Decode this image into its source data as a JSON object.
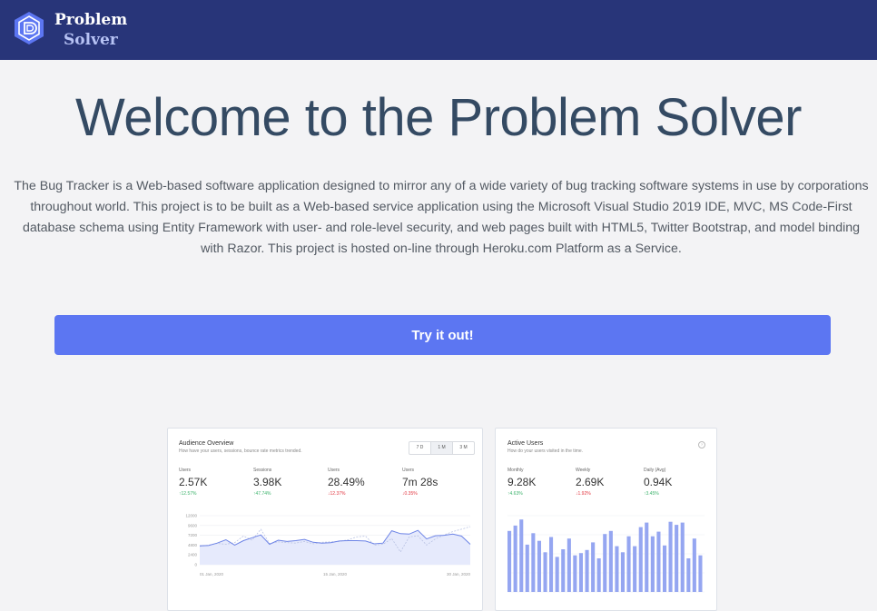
{
  "app": {
    "brand_line1": "Problem",
    "brand_line2": "Solver",
    "brand_icon": "document-hexagon-icon"
  },
  "hero": {
    "title": "Welcome to the Problem Solver",
    "description": "The Bug Tracker is a Web-based software application designed to mirror any of a wide variety of bug tracking software systems in use by corporations throughout world. This project is to be built as a Web-based service application using the Microsoft Visual Studio 2019 IDE, MVC, MS Code-First database schema using Entity Framework with user- and role-level security, and web pages built with HTML5, Twitter Bootstrap, and model binding with Razor. This project is hosted on-line through Heroku.com Platform as a Service.",
    "cta_label": "Try it out!"
  },
  "colors": {
    "navbar": "#283579",
    "accent": "#5c76f2",
    "up": "#3bb26b",
    "down": "#e1353f"
  },
  "audience": {
    "title": "Audience Overview",
    "subtitle": "How have your users, sessions, bounce rate metrics trended.",
    "range_tabs": [
      "7 D",
      "1 M",
      "3 M"
    ],
    "active_tab": "1 M",
    "stats": [
      {
        "label": "Users",
        "value": "2.57K",
        "change": "↑12.57%",
        "trend": "up"
      },
      {
        "label": "Sessions",
        "value": "3.98K",
        "change": "↑47.74%",
        "trend": "up"
      },
      {
        "label": "Users",
        "value": "28.49%",
        "change": "↓12.37%",
        "trend": "down"
      },
      {
        "label": "Users",
        "value": "7m 28s",
        "change": "↓0.35%",
        "trend": "down"
      }
    ]
  },
  "active_users": {
    "title": "Active Users",
    "subtitle": "How do your users visited in the time.",
    "stats": [
      {
        "label": "Monthly",
        "value": "9.28K",
        "change": "↑4.63%",
        "trend": "up"
      },
      {
        "label": "Weekly",
        "value": "2.69K",
        "change": "↓1.92%",
        "trend": "down"
      },
      {
        "label": "Daily (Avg)",
        "value": "0.94K",
        "change": "↑3.45%",
        "trend": "up"
      }
    ]
  },
  "chart_data": [
    {
      "type": "area",
      "ylim": [
        0,
        12000
      ],
      "yticks": [
        "12000",
        "9600",
        "7200",
        "4800",
        "2400",
        "0"
      ],
      "xticks": [
        "01 Jan, 2020",
        "15 Jan, 2020",
        "30 Jan, 2020"
      ],
      "series": [
        {
          "values": [
            4600,
            4700,
            5300,
            6100,
            4800,
            5900,
            6600,
            7300,
            5000,
            6000,
            5700,
            5900,
            6200,
            5500,
            5300,
            5400,
            5800,
            5900,
            5900,
            5800,
            5100,
            5300,
            8300,
            7600,
            7500,
            8400,
            6300,
            7100,
            7200,
            7500,
            7000,
            5000
          ]
        },
        {
          "values": [
            4500,
            4800,
            5200,
            5000,
            5400,
            7000,
            6000,
            8700,
            5200,
            5600,
            5400,
            5300,
            5700,
            5100,
            5500,
            5600,
            5700,
            6100,
            6800,
            7000,
            4800,
            5000,
            6400,
            3100,
            6800,
            7100,
            4800,
            6300,
            7300,
            8100,
            8700,
            9300
          ]
        }
      ]
    },
    {
      "type": "bar",
      "values": [
        80,
        87,
        95,
        62,
        77,
        67,
        52,
        72,
        46,
        56,
        70,
        48,
        51,
        55,
        65,
        44,
        76,
        80,
        60,
        52,
        73,
        60,
        85,
        91,
        73,
        79,
        61,
        92,
        88,
        91,
        44,
        70,
        48
      ]
    }
  ]
}
